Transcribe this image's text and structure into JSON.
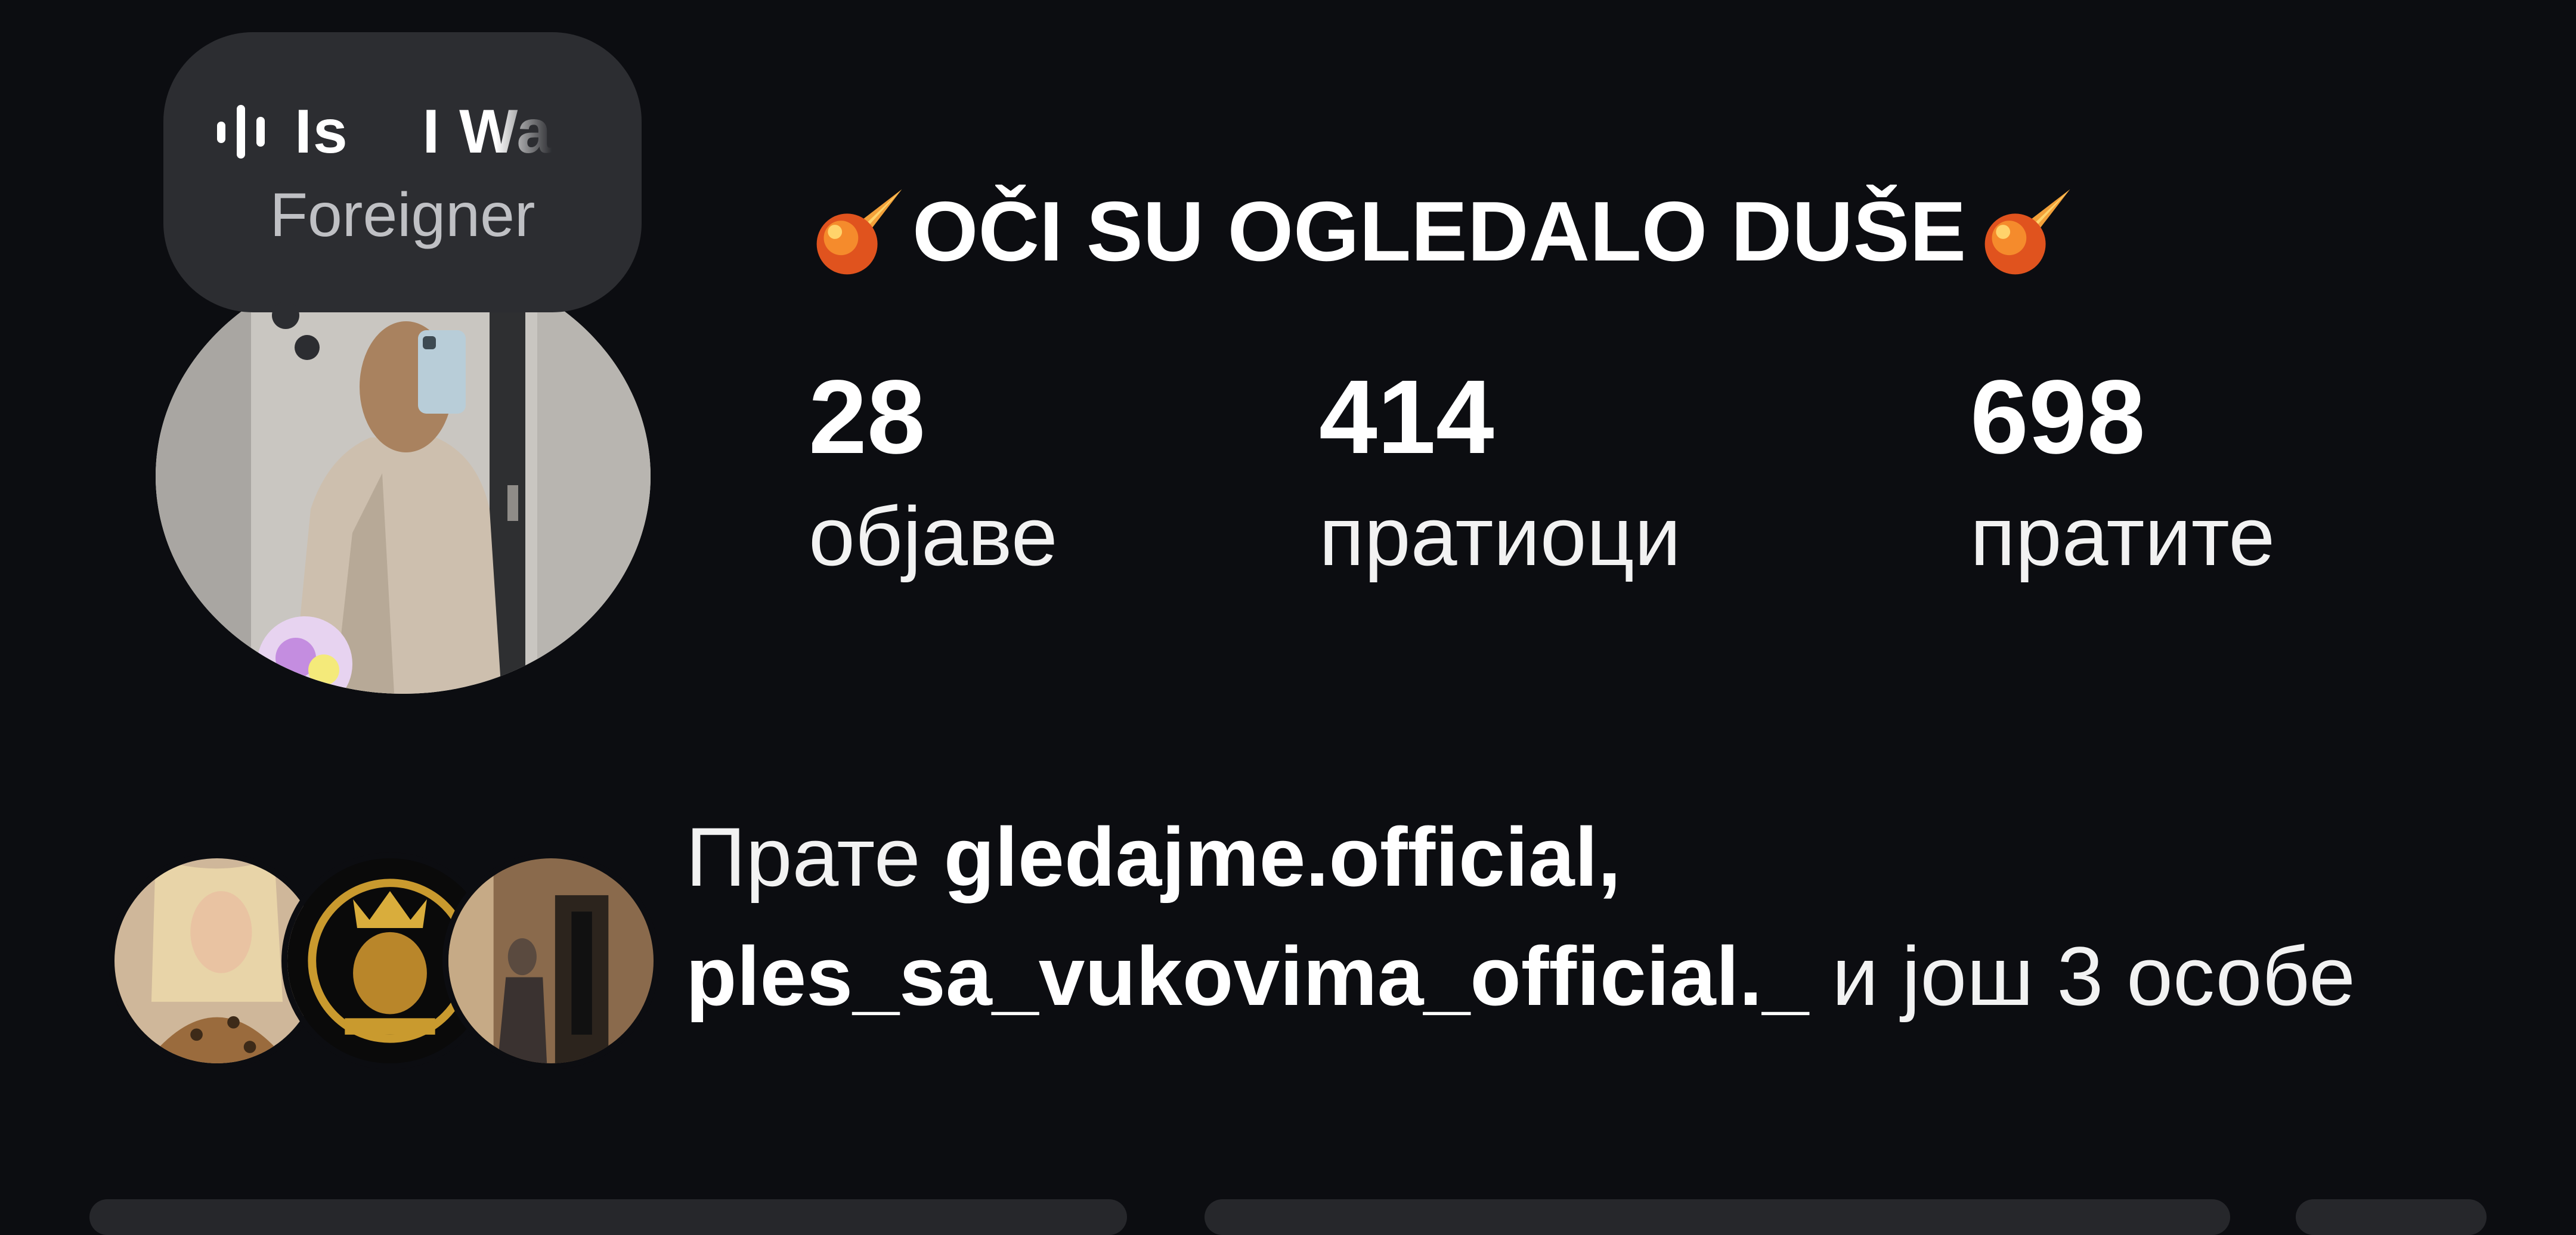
{
  "note": {
    "song_title": "Is    I Wa",
    "artist": "Foreigner",
    "icon": "audio-bars-icon"
  },
  "profile": {
    "name": "OČI SU OGLEDALO DUŠE",
    "name_emoji": "comet-icon"
  },
  "stats": {
    "posts": {
      "value": "28",
      "label": "објаве"
    },
    "followers": {
      "value": "414",
      "label": "пратиоци"
    },
    "following": {
      "value": "698",
      "label": "пратите"
    }
  },
  "followed_by": {
    "prefix": "Прате ",
    "user1": "gledajme.official",
    "sep": ",",
    "user2": "ples_sa_vukovima_official._",
    "suffix": " и још 3 особе"
  },
  "colors": {
    "background": "#0c0d11",
    "bubble": "#2c2d31",
    "text": "#ffffff"
  }
}
